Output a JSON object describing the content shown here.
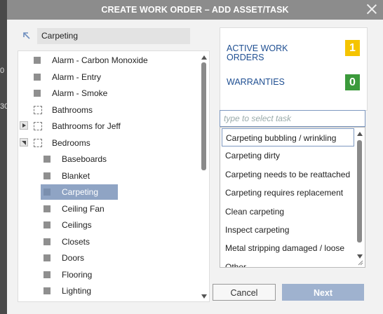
{
  "dialog": {
    "title": "CREATE WORK ORDER – ADD ASSET/TASK",
    "close_icon": "close-icon"
  },
  "breadcrumb": {
    "current": "Carpeting",
    "up_icon": "arrow-up-left-icon"
  },
  "tree": {
    "items": [
      {
        "label": "Alarm - Carbon Monoxide",
        "level": 0,
        "icon": "asset-icon",
        "expander": "none"
      },
      {
        "label": "Alarm - Entry",
        "level": 0,
        "icon": "asset-icon",
        "expander": "none"
      },
      {
        "label": "Alarm - Smoke",
        "level": 0,
        "icon": "asset-icon",
        "expander": "none"
      },
      {
        "label": "Bathrooms",
        "level": 0,
        "icon": "group-icon",
        "expander": "none"
      },
      {
        "label": "Bathrooms for Jeff",
        "level": 0,
        "icon": "group-icon",
        "expander": "collapsed"
      },
      {
        "label": "Bedrooms",
        "level": 0,
        "icon": "group-icon",
        "expander": "expanded"
      },
      {
        "label": "Baseboards",
        "level": 1,
        "icon": "asset-icon",
        "expander": "none"
      },
      {
        "label": "Blanket",
        "level": 1,
        "icon": "asset-icon",
        "expander": "none"
      },
      {
        "label": "Carpeting",
        "level": 1,
        "icon": "asset-icon",
        "expander": "none",
        "selected": true
      },
      {
        "label": "Ceiling Fan",
        "level": 1,
        "icon": "asset-icon",
        "expander": "none"
      },
      {
        "label": "Ceilings",
        "level": 1,
        "icon": "asset-icon",
        "expander": "none"
      },
      {
        "label": "Closets",
        "level": 1,
        "icon": "asset-icon",
        "expander": "none"
      },
      {
        "label": "Doors",
        "level": 1,
        "icon": "asset-icon",
        "expander": "none"
      },
      {
        "label": "Flooring",
        "level": 1,
        "icon": "asset-icon",
        "expander": "none"
      },
      {
        "label": "Lighting",
        "level": 1,
        "icon": "asset-icon",
        "expander": "none"
      }
    ]
  },
  "stats": {
    "active": {
      "label": "ACTIVE WORK ORDERS",
      "count": "1",
      "color": "#f5c400"
    },
    "warranties": {
      "label": "WARRANTIES",
      "count": "0",
      "color": "#3b9a3b"
    }
  },
  "task_search": {
    "placeholder": "type to select task",
    "value": ""
  },
  "tasks": {
    "items": [
      "Carpeting bubbling / wrinkling",
      "Carpeting dirty",
      "Carpeting needs to be reattached",
      "Carpeting requires replacement",
      "Clean carpeting",
      "Inspect carpeting",
      "Metal stripping damaged / loose",
      "Other"
    ],
    "highlighted_index": 0
  },
  "buttons": {
    "cancel": "Cancel",
    "next": "Next"
  },
  "colors": {
    "link": "#1f4f92",
    "accent": "#9fb2cf",
    "selection": "#8fa4c4",
    "titlebar": "#8c8c8c"
  }
}
